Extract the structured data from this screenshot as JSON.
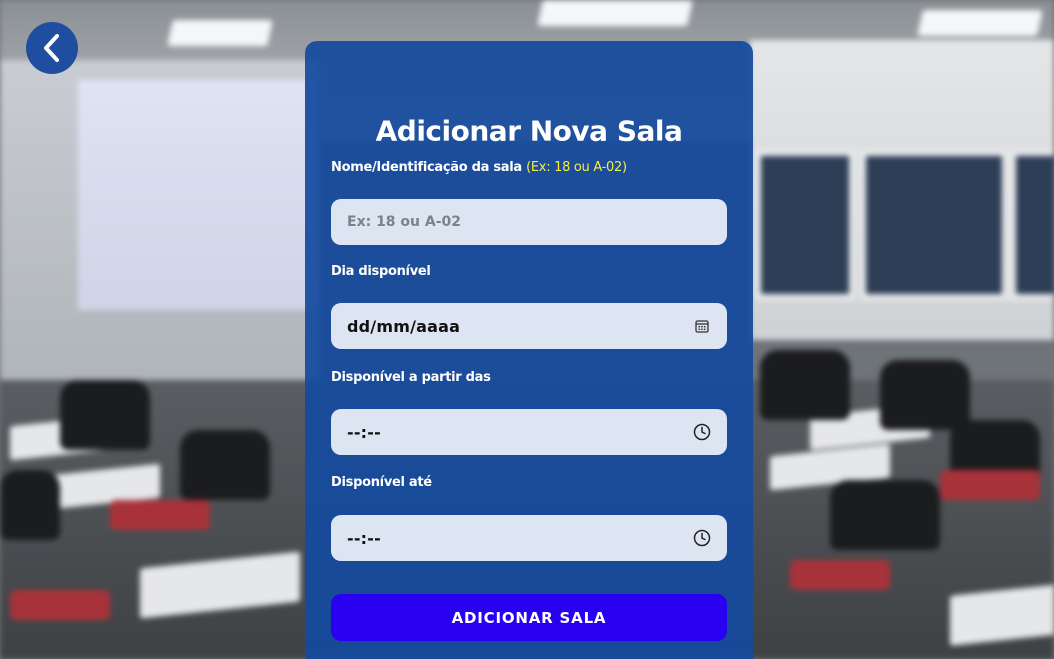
{
  "form": {
    "title": "Adicionar Nova Sala",
    "name_field": {
      "label": "Nome/Identificação da sala",
      "hint": "(Ex: 18 ou A-02)",
      "placeholder": "Ex: 18 ou A-02"
    },
    "date_field": {
      "label": "Dia disponível",
      "value": "dd/mm/aaaa",
      "icon": "calendar-icon"
    },
    "start_field": {
      "label": "Disponível a partir das",
      "value": "--:--",
      "icon": "clock-icon"
    },
    "end_field": {
      "label": "Disponível até",
      "value": "--:--",
      "icon": "clock-icon"
    },
    "submit_label": "ADICIONAR SALA"
  },
  "nav": {
    "back_icon": "chevron-left-icon"
  },
  "colors": {
    "panel": "#144a9e",
    "back_button": "#1f4ea0",
    "field_bg": "#dde5f3",
    "hint": "#f4ef3e",
    "submit": "#2a00f0"
  }
}
